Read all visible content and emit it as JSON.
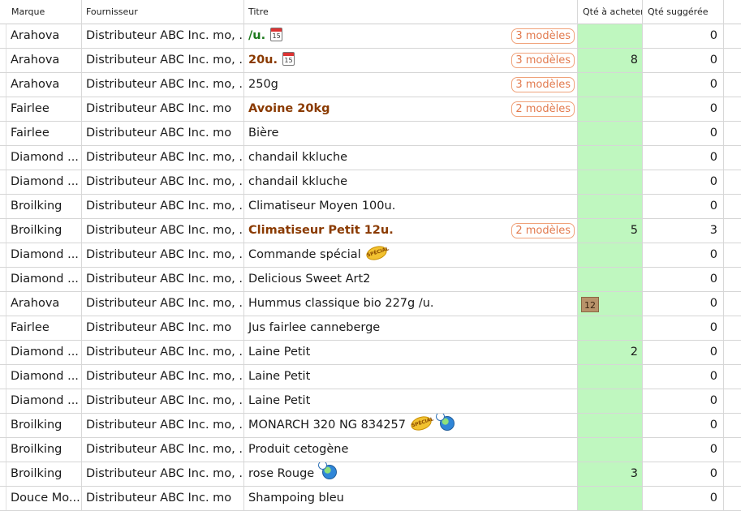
{
  "columns": {
    "marque": "Marque",
    "fournisseur": "Fournisseur",
    "titre": "Titre",
    "acheter": "Qté à acheter",
    "suggeree": "Qté suggérée"
  },
  "rows": [
    {
      "marque": "Arahova",
      "fournisseur": "Distributeur ABC Inc. mo, ...",
      "titre": "/u.",
      "style": "bold-green",
      "icons": [
        "calendar-icon"
      ],
      "badge": "3 modèles",
      "acheter": "",
      "suggeree": "0"
    },
    {
      "marque": "Arahova",
      "fournisseur": "Distributeur ABC Inc. mo, ...",
      "titre": "20u.",
      "style": "bold-brown",
      "icons": [
        "calendar-icon"
      ],
      "badge": "3 modèles",
      "acheter": "8",
      "suggeree": "0"
    },
    {
      "marque": "Arahova",
      "fournisseur": "Distributeur ABC Inc. mo, ...",
      "titre": "250g",
      "style": "",
      "icons": [],
      "badge": "3 modèles",
      "acheter": "",
      "suggeree": "0"
    },
    {
      "marque": "Fairlee",
      "fournisseur": "Distributeur ABC Inc. mo",
      "titre": "Avoine 20kg",
      "style": "bold-brown",
      "icons": [],
      "badge": "2 modèles",
      "acheter": "",
      "suggeree": "0"
    },
    {
      "marque": "Fairlee",
      "fournisseur": "Distributeur ABC Inc. mo",
      "titre": "Bière",
      "style": "",
      "icons": [],
      "badge": "",
      "acheter": "",
      "suggeree": "0"
    },
    {
      "marque": "Diamond ...",
      "fournisseur": "Distributeur ABC Inc. mo, ...",
      "titre": "chandail kkluche",
      "style": "",
      "icons": [],
      "badge": "",
      "acheter": "",
      "suggeree": "0"
    },
    {
      "marque": "Diamond ...",
      "fournisseur": "Distributeur ABC Inc. mo, ...",
      "titre": "chandail kkluche",
      "style": "",
      "icons": [],
      "badge": "",
      "acheter": "",
      "suggeree": "0"
    },
    {
      "marque": "Broilking",
      "fournisseur": "Distributeur ABC Inc. mo, ...",
      "titre": "Climatiseur Moyen 100u.",
      "style": "",
      "icons": [],
      "badge": "",
      "acheter": "",
      "suggeree": "0"
    },
    {
      "marque": "Broilking",
      "fournisseur": "Distributeur ABC Inc. mo, ...",
      "titre": "Climatiseur Petit 12u.",
      "style": "bold-brown",
      "icons": [],
      "badge": "2 modèles",
      "acheter": "5",
      "suggeree": "3"
    },
    {
      "marque": "Diamond ...",
      "fournisseur": "Distributeur ABC Inc. mo, ...",
      "titre": "Commande spécial",
      "style": "",
      "icons": [
        "special-icon"
      ],
      "badge": "",
      "acheter": "",
      "suggeree": "0"
    },
    {
      "marque": "Diamond ...",
      "fournisseur": "Distributeur ABC Inc. mo, ...",
      "titre": "Delicious Sweet Art2",
      "style": "",
      "icons": [],
      "badge": "",
      "acheter": "",
      "suggeree": "0"
    },
    {
      "marque": "Arahova",
      "fournisseur": "Distributeur ABC Inc. mo, ...",
      "titre": "Hummus classique bio 227g /u.",
      "style": "",
      "icons": [],
      "badge": "",
      "acheter": "",
      "box": "12",
      "suggeree": "0"
    },
    {
      "marque": "Fairlee",
      "fournisseur": "Distributeur ABC Inc. mo",
      "titre": "Jus fairlee canneberge",
      "style": "",
      "icons": [],
      "badge": "",
      "acheter": "",
      "suggeree": "0"
    },
    {
      "marque": "Diamond ...",
      "fournisseur": "Distributeur ABC Inc. mo, ...",
      "titre": "Laine Petit",
      "style": "",
      "icons": [],
      "badge": "",
      "acheter": "2",
      "suggeree": "0"
    },
    {
      "marque": "Diamond ...",
      "fournisseur": "Distributeur ABC Inc. mo, ...",
      "titre": "Laine Petit",
      "style": "",
      "icons": [],
      "badge": "",
      "acheter": "",
      "suggeree": "0"
    },
    {
      "marque": "Diamond ...",
      "fournisseur": "Distributeur ABC Inc. mo, ...",
      "titre": "Laine Petit",
      "style": "",
      "icons": [],
      "badge": "",
      "acheter": "",
      "suggeree": "0"
    },
    {
      "marque": "Broilking",
      "fournisseur": "Distributeur ABC Inc. mo, ...",
      "titre": "MONARCH 320 NG 834257",
      "style": "",
      "icons": [
        "special-icon",
        "globe-icon"
      ],
      "badge": "",
      "acheter": "",
      "suggeree": "0"
    },
    {
      "marque": "Broilking",
      "fournisseur": "Distributeur ABC Inc. mo, ...",
      "titre": "Produit cetogène",
      "style": "",
      "icons": [],
      "badge": "",
      "acheter": "",
      "suggeree": "0"
    },
    {
      "marque": "Broilking",
      "fournisseur": "Distributeur ABC Inc. mo, ...",
      "titre": "rose Rouge",
      "style": "",
      "icons": [
        "globe-icon"
      ],
      "badge": "",
      "acheter": "3",
      "suggeree": "0"
    },
    {
      "marque": "Douce Mo...",
      "fournisseur": "Distributeur ABC Inc. mo",
      "titre": "Shampoing bleu",
      "style": "",
      "icons": [],
      "badge": "",
      "acheter": "",
      "suggeree": "0"
    }
  ],
  "icon_text": {
    "calendar": "15",
    "special": "SPÉCIAL"
  },
  "colors": {
    "acheter_bg": "#bff7bf",
    "badge": "#e27a4e",
    "bold_green": "#1d7a1d",
    "bold_brown": "#8a3a00"
  }
}
